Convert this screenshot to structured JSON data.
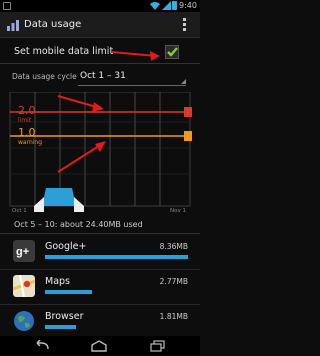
{
  "status_bar": {
    "time": "9:40"
  },
  "action_bar": {
    "title": "Data usage"
  },
  "mobile_limit": {
    "label": "Set mobile data limit",
    "checked": true
  },
  "cycle": {
    "label": "Data usage cycle",
    "value": "Oct 1 – 31"
  },
  "chart": {
    "limit_value": "2.0",
    "limit_label": "limit",
    "warning_value": "1.0",
    "warning_label": "warning",
    "tick_start": "Oct 1",
    "tick_end": "Nov 1"
  },
  "summary": "Oct 5 – 10: about 24.40MB used",
  "apps": [
    {
      "name": "Google+",
      "size": "8.36MB",
      "fraction": 1.0,
      "color": "#ffffff"
    },
    {
      "name": "Maps",
      "size": "2.77MB",
      "fraction": 0.33,
      "color": "#ffffff"
    },
    {
      "name": "Browser",
      "size": "1.81MB",
      "fraction": 0.22,
      "color": "#ffffff"
    }
  ],
  "colors": {
    "accent": "#2e9fd6",
    "limit": "#d93a2b",
    "warning": "#f39a1d",
    "annotation_arrow": "#e01b1b"
  }
}
